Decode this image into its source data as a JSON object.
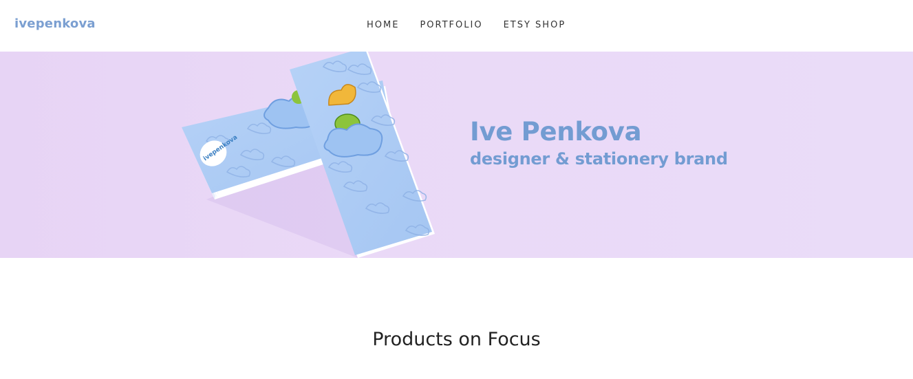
{
  "header": {
    "logo": "ivepenkova",
    "nav": [
      "HOME",
      "PORTFOLIO",
      "ETSY SHOP"
    ]
  },
  "hero": {
    "title": "Ive Penkova",
    "subtitle": "designer & stationery brand",
    "card_logo": "ivepenkova"
  },
  "main": {
    "section_title": "Products on Focus"
  },
  "colors": {
    "brand": "#739cd2",
    "hero_bg": "#eadcf8",
    "card": "#aecdf6"
  }
}
